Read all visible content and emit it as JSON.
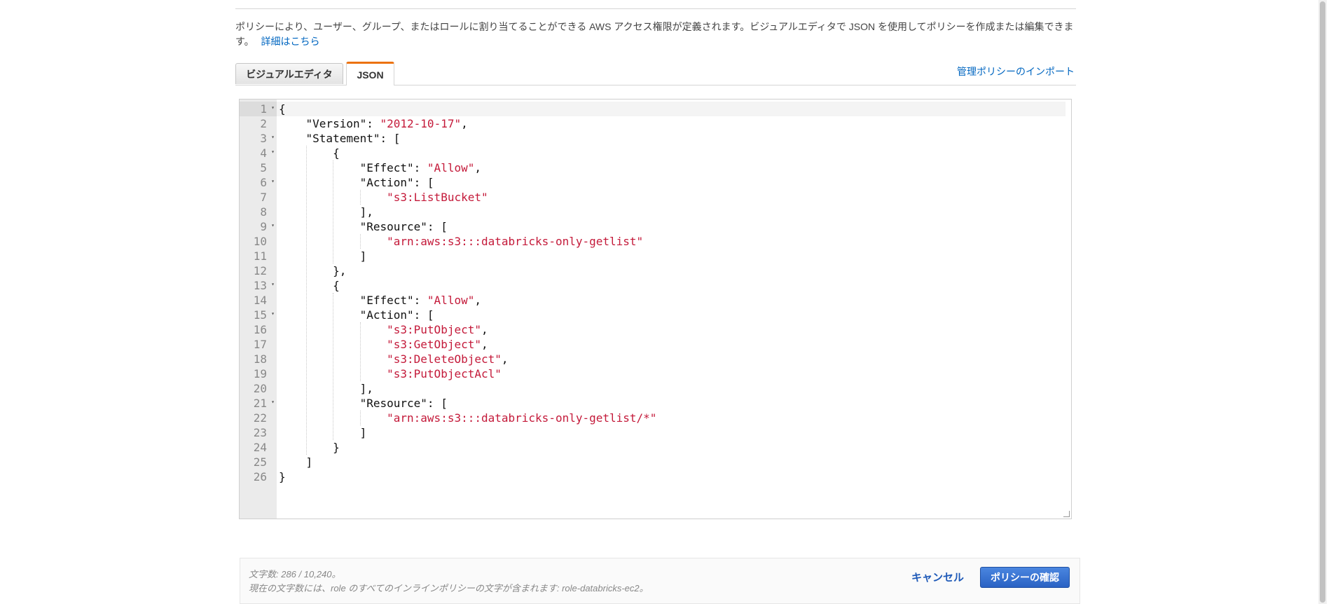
{
  "description": {
    "text": "ポリシーにより、ユーザー、グループ、またはロールに割り当てることができる AWS アクセス権限が定義されます。ビジュアルエディタで JSON を使用してポリシーを作成または編集できます。",
    "learn_more": "詳細はこちら"
  },
  "tabs": {
    "visual": "ビジュアルエディタ",
    "json": "JSON"
  },
  "import_link": "管理ポリシーのインポート",
  "editor": {
    "fold_marker": "▾",
    "lines": [
      {
        "n": "1",
        "t": [
          {
            "v": "{"
          }
        ]
      },
      {
        "n": "2",
        "t": [
          {
            "v": "    \"Version\": "
          },
          {
            "v": "\"2012-10-17\"",
            "s": true
          },
          {
            "v": ","
          }
        ]
      },
      {
        "n": "3",
        "t": [
          {
            "v": "    \"Statement\": ["
          }
        ]
      },
      {
        "n": "4",
        "t": [
          {
            "v": "        {"
          }
        ]
      },
      {
        "n": "5",
        "t": [
          {
            "v": "            \"Effect\": "
          },
          {
            "v": "\"Allow\"",
            "s": true
          },
          {
            "v": ","
          }
        ]
      },
      {
        "n": "6",
        "t": [
          {
            "v": "            \"Action\": ["
          }
        ]
      },
      {
        "n": "7",
        "t": [
          {
            "v": "                "
          },
          {
            "v": "\"s3:ListBucket\"",
            "s": true
          }
        ]
      },
      {
        "n": "8",
        "t": [
          {
            "v": "            ],"
          }
        ]
      },
      {
        "n": "9",
        "t": [
          {
            "v": "            \"Resource\": ["
          }
        ]
      },
      {
        "n": "10",
        "t": [
          {
            "v": "                "
          },
          {
            "v": "\"arn:aws:s3:::databricks-only-getlist\"",
            "s": true
          }
        ]
      },
      {
        "n": "11",
        "t": [
          {
            "v": "            ]"
          }
        ]
      },
      {
        "n": "12",
        "t": [
          {
            "v": "        },"
          }
        ]
      },
      {
        "n": "13",
        "t": [
          {
            "v": "        {"
          }
        ]
      },
      {
        "n": "14",
        "t": [
          {
            "v": "            \"Effect\": "
          },
          {
            "v": "\"Allow\"",
            "s": true
          },
          {
            "v": ","
          }
        ]
      },
      {
        "n": "15",
        "t": [
          {
            "v": "            \"Action\": ["
          }
        ]
      },
      {
        "n": "16",
        "t": [
          {
            "v": "                "
          },
          {
            "v": "\"s3:PutObject\"",
            "s": true
          },
          {
            "v": ","
          }
        ]
      },
      {
        "n": "17",
        "t": [
          {
            "v": "                "
          },
          {
            "v": "\"s3:GetObject\"",
            "s": true
          },
          {
            "v": ","
          }
        ]
      },
      {
        "n": "18",
        "t": [
          {
            "v": "                "
          },
          {
            "v": "\"s3:DeleteObject\"",
            "s": true
          },
          {
            "v": ","
          }
        ]
      },
      {
        "n": "19",
        "t": [
          {
            "v": "                "
          },
          {
            "v": "\"s3:PutObjectAcl\"",
            "s": true
          }
        ]
      },
      {
        "n": "20",
        "t": [
          {
            "v": "            ],"
          }
        ]
      },
      {
        "n": "21",
        "t": [
          {
            "v": "            \"Resource\": ["
          }
        ]
      },
      {
        "n": "22",
        "t": [
          {
            "v": "                "
          },
          {
            "v": "\"arn:aws:s3:::databricks-only-getlist/*\"",
            "s": true
          }
        ]
      },
      {
        "n": "23",
        "t": [
          {
            "v": "            ]"
          }
        ]
      },
      {
        "n": "24",
        "t": [
          {
            "v": "        }"
          }
        ]
      },
      {
        "n": "25",
        "t": [
          {
            "v": "    ]"
          }
        ]
      },
      {
        "n": "26",
        "t": [
          {
            "v": "}"
          }
        ]
      }
    ],
    "foldable": [
      "1",
      "3",
      "4",
      "6",
      "9",
      "13",
      "15",
      "21"
    ]
  },
  "footer": {
    "char_count": "文字数: 286 / 10,240。",
    "char_note": "現在の文字数には、role のすべてのインラインポリシーの文字が含まれます: role-databricks-ec2。",
    "cancel": "キャンセル",
    "confirm": "ポリシーの確認"
  },
  "colors": {
    "string": "#c41a3a",
    "link": "#0066c0",
    "tab_accent": "#ec7211",
    "primary_button": "#2a62c4"
  }
}
